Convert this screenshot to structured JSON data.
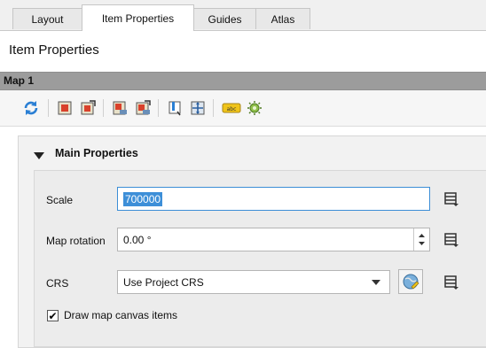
{
  "tabs": [
    {
      "label": "Layout",
      "active": false
    },
    {
      "label": "Item Properties",
      "active": true
    },
    {
      "label": "Guides",
      "active": false
    },
    {
      "label": "Atlas",
      "active": false
    }
  ],
  "panel": {
    "title": "Item Properties"
  },
  "map": {
    "name": "Map 1"
  },
  "toolbar": {
    "icons": [
      "refresh-icon",
      "set-to-canvas-extent-icon",
      "view-extent-in-canvas-icon",
      "set-to-canvas-scale-icon",
      "set-canvas-to-map-scale-icon",
      "bookmarks-icon",
      "move-content-icon",
      "label-settings-icon",
      "temporal-settings-icon"
    ]
  },
  "main_properties": {
    "title": "Main Properties",
    "scale": {
      "label": "Scale",
      "value": "700000"
    },
    "rotation": {
      "label": "Map rotation",
      "value": "0.00 °"
    },
    "crs": {
      "label": "CRS",
      "value": "Use Project CRS"
    },
    "draw_canvas_items": {
      "label": "Draw map canvas items",
      "checked": true
    }
  },
  "colors": {
    "accent": "#3d8fd8",
    "header_bar": "#9c9c9c"
  }
}
